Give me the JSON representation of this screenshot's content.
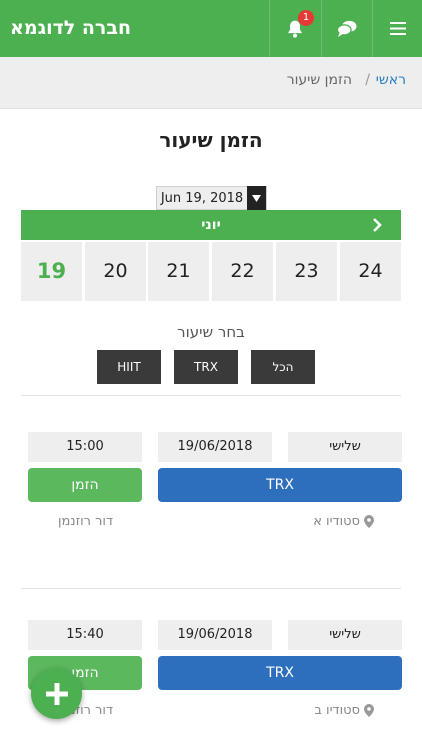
{
  "header": {
    "brand": "חברה לדוגמא",
    "notifications_count": "1",
    "bell_icon": "bell-icon",
    "chat_icon": "chat-icon",
    "menu_icon": "menu-icon",
    "accent": "#4caf50"
  },
  "breadcrumb": {
    "home": "ראשי",
    "separator": "/",
    "current": "הזמן שיעור"
  },
  "page": {
    "title": "הזמן שיעור"
  },
  "date_picker": {
    "value": "Jun 19, 2018"
  },
  "calendar": {
    "month": "יוני",
    "days": [
      "24",
      "23",
      "22",
      "21",
      "20",
      "19"
    ],
    "selected_day": "19"
  },
  "filter": {
    "label": "בחר שיעור",
    "options": [
      "הכל",
      "TRX",
      "HIIT"
    ]
  },
  "classes": [
    {
      "day": "שלישי",
      "date": "19/06/2018",
      "time": "15:00",
      "name": "TRX",
      "book_label": "הזמן",
      "studio": "סטודיו א",
      "trainer": "דור רוזנמן"
    },
    {
      "day": "שלישי",
      "date": "19/06/2018",
      "time": "15:40",
      "name": "TRX",
      "book_label": "הזמן",
      "studio": "סטודיו ב",
      "trainer": "דור רוזנמן"
    }
  ],
  "fab": {
    "icon": "plus-icon"
  }
}
